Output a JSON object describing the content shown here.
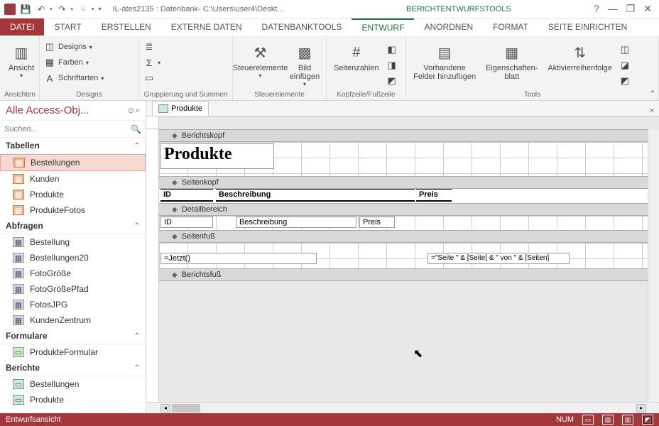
{
  "titlebar": {
    "app_title": "IL-ates2135 : Datenbank- C:\\Users\\user4\\Deskt...",
    "context_title": "BERICHTENTWURFSTOOLS"
  },
  "tabs": {
    "file": "DATEI",
    "start": "START",
    "create": "ERSTELLEN",
    "external": "EXTERNE DATEN",
    "dbtools": "DATENBANKTOOLS",
    "design": "ENTWURF",
    "arrange": "ANORDNEN",
    "format": "FORMAT",
    "pagesetup": "SEITE EINRICHTEN"
  },
  "ribbon": {
    "views": {
      "button": "Ansicht",
      "group": "Ansichten"
    },
    "designs": {
      "designs": "Designs",
      "colors": "Farben",
      "fonts": "Schriftarten",
      "group": "Designs"
    },
    "grouping": {
      "group": "Gruppierung und Summen"
    },
    "controls": {
      "button": "Steuerelemente",
      "image": "Bild\neinfügen",
      "group": "Steuerelemente"
    },
    "headerfooter": {
      "pagenum": "Seitenzahlen",
      "group": "Kopfzeile/Fußzeile"
    },
    "tools": {
      "addfields": "Vorhandene\nFelder hinzufügen",
      "propsheet": "Eigenschaften-\nblatt",
      "taborder": "Aktivierreihenfolge",
      "group": "Tools"
    }
  },
  "nav": {
    "header": "Alle Access-Obj...",
    "search_placeholder": "Suchen...",
    "cat_tables": "Tabellen",
    "cat_queries": "Abfragen",
    "cat_forms": "Formulare",
    "cat_reports": "Berichte",
    "tables": [
      "Bestellungen",
      "Kunden",
      "Produkte",
      "ProdukteFotos"
    ],
    "queries": [
      "Bestellung",
      "Bestellungen20",
      "FotoGröße",
      "FotoGrößePfad",
      "FotosJPG",
      "KundenZentrum"
    ],
    "forms": [
      "ProdukteFormular"
    ],
    "reports": [
      "Bestellungen",
      "Produkte"
    ]
  },
  "doc": {
    "tab_name": "Produkte",
    "sections": {
      "report_header": "Berichtskopf",
      "page_header": "Seitenkopf",
      "detail": "Detailbereich",
      "page_footer": "Seitenfuß",
      "report_footer": "Berichtsfuß"
    },
    "title_label": "Produkte",
    "columns": {
      "id": "ID",
      "desc": "Beschreibung",
      "price": "Preis"
    },
    "fields": {
      "id": "ID",
      "desc": "Beschreibung",
      "price": "Preis"
    },
    "footer": {
      "now": "=Jetzt()",
      "page": "=\"Seite \" & [Seite] & \" von \" & [Seiten]"
    }
  },
  "status": {
    "view": "Entwurfsansicht",
    "num": "NUM"
  }
}
